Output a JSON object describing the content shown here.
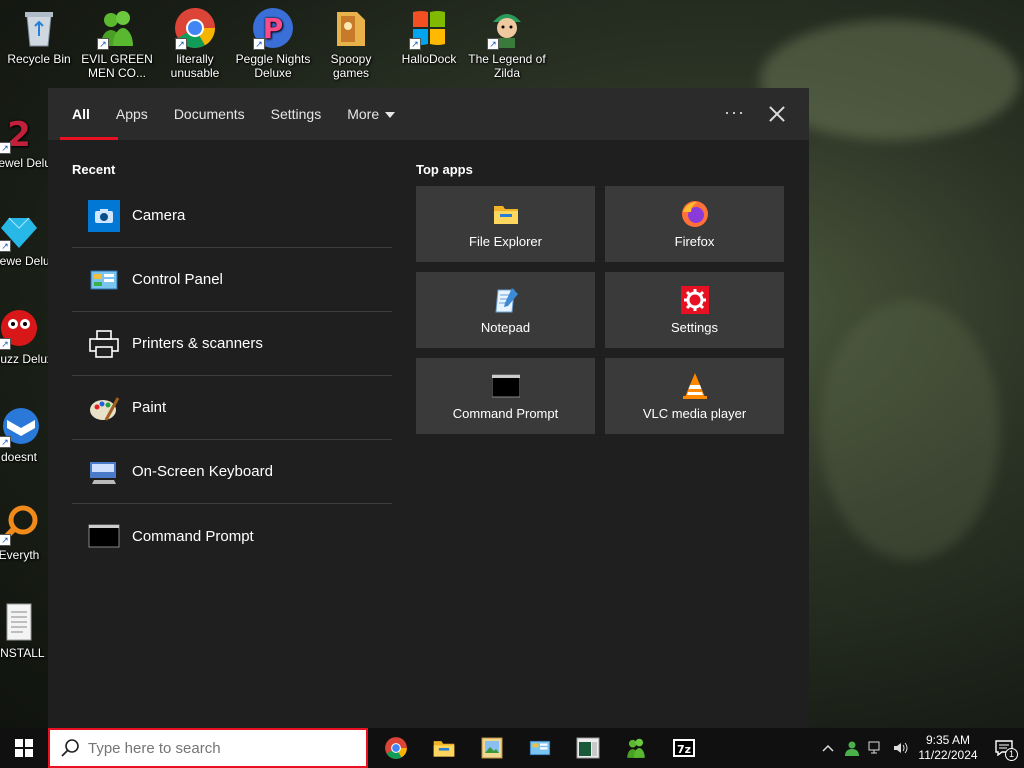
{
  "desktop_icons": [
    {
      "label": "Recycle Bin",
      "icon": "recycle-bin-icon"
    },
    {
      "label": "EVIL GREEN MEN CO...",
      "icon": "green-men-icon"
    },
    {
      "label": "literally unusable",
      "icon": "chrome-icon"
    },
    {
      "label": "Peggle Nights Deluxe",
      "icon": "peggle-icon"
    },
    {
      "label": "Spoopy games",
      "icon": "folder-icon"
    },
    {
      "label": "HalloDock",
      "icon": "windows-logo-icon"
    },
    {
      "label": "The Legend of Zilda",
      "icon": "zilda-icon"
    },
    {
      "label": "Bejewel Delux",
      "icon": "bejeweled-icon"
    },
    {
      "label": "Bejewe Delux",
      "icon": "bejeweled-diamond-icon"
    },
    {
      "label": "Chuzz Delux",
      "icon": "chuzzle-icon"
    },
    {
      "label": "doesnt",
      "icon": "thunderbird-icon"
    },
    {
      "label": "Everyth",
      "icon": "everything-search-icon"
    },
    {
      "label": "!INSTALL",
      "icon": "text-document-icon"
    }
  ],
  "panel": {
    "tabs": [
      {
        "label": "All",
        "active": true
      },
      {
        "label": "Apps"
      },
      {
        "label": "Documents"
      },
      {
        "label": "Settings"
      },
      {
        "label": "More"
      }
    ],
    "more_options_label": "···",
    "recent_title": "Recent",
    "recent": [
      {
        "label": "Camera",
        "icon": "camera-icon"
      },
      {
        "label": "Control Panel",
        "icon": "control-panel-icon"
      },
      {
        "label": "Printers & scanners",
        "icon": "printer-icon"
      },
      {
        "label": "Paint",
        "icon": "paint-icon"
      },
      {
        "label": "On-Screen Keyboard",
        "icon": "keyboard-icon"
      },
      {
        "label": "Command Prompt",
        "icon": "command-prompt-icon"
      }
    ],
    "top_apps_title": "Top apps",
    "top_apps": [
      {
        "label": "File Explorer",
        "icon": "file-explorer-icon"
      },
      {
        "label": "Firefox",
        "icon": "firefox-icon"
      },
      {
        "label": "Notepad",
        "icon": "notepad-icon"
      },
      {
        "label": "Settings",
        "icon": "settings-gear-icon"
      },
      {
        "label": "Command Prompt",
        "icon": "command-prompt-icon"
      },
      {
        "label": "VLC media player",
        "icon": "vlc-icon"
      }
    ]
  },
  "taskbar": {
    "search_placeholder": "Type here to search",
    "apps": [
      "chrome-icon",
      "file-explorer-icon",
      "image-viewer-icon",
      "control-panel-icon",
      "terminal-window-icon",
      "green-men-icon",
      "7zip-icon"
    ],
    "clock_time": "9:35 AM",
    "clock_date": "11/22/2024",
    "notification_count": "1"
  },
  "colors": {
    "accent": "#e81123",
    "panel_bg": "#1f1f1f",
    "tile_bg": "#3a3a3a"
  }
}
